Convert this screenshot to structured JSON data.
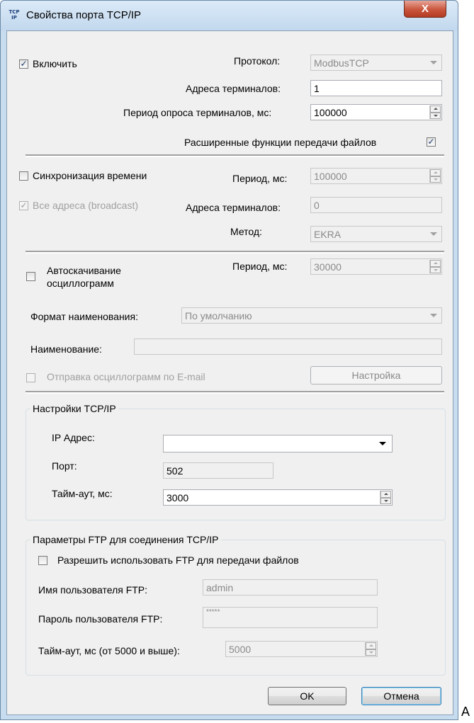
{
  "window": {
    "title": "Свойства порта TCP/IP",
    "icon_text_top": "TCP",
    "icon_text_bottom": "IP",
    "close_label": "X"
  },
  "general": {
    "enable_label": "Включить",
    "enable_checked": true,
    "protocol_label": "Протокол:",
    "protocol_value": "ModbusTCP",
    "terminal_addresses_label": "Адреса терминалов:",
    "terminal_addresses_value": "1",
    "poll_period_label": "Период опроса терминалов, мс:",
    "poll_period_value": "100000",
    "extended_ft_label": "Расширенные функции передачи файлов",
    "extended_ft_checked": true
  },
  "time_sync": {
    "sync_label": "Синхронизация времени",
    "sync_checked": false,
    "period_label": "Период, мс:",
    "period_value": "100000",
    "broadcast_label": "Все адреса (broadcast)",
    "broadcast_checked": true,
    "terminal_addresses_label": "Адреса терминалов:",
    "terminal_addresses_value": "0",
    "method_label": "Метод:",
    "method_value": "EKRA"
  },
  "oscillogram": {
    "autodownload_label_line1": "Автоскачивание",
    "autodownload_label_line2": "осциллограмм",
    "autodownload_checked": false,
    "period_label": "Период, мс:",
    "period_value": "30000",
    "naming_format_label": "Формат наименования:",
    "naming_format_value": "По умолчанию",
    "name_label": "Наименование:",
    "name_value": "",
    "email_label": "Отправка осциллограмм по E-mail",
    "email_checked": false,
    "settings_button": "Настройка"
  },
  "tcp": {
    "group_title": "Настройки TCP/IP",
    "ip_label": "IP Адрес:",
    "ip_value": "",
    "port_label": "Порт:",
    "port_value": "502",
    "timeout_label": "Тайм-аут, мс:",
    "timeout_value": "3000"
  },
  "ftp": {
    "group_title": "Параметры FTP для соединения TCP/IP",
    "allow_label": "Разрешить использовать FTP для передачи файлов",
    "allow_checked": false,
    "user_label": "Имя пользователя FTP:",
    "user_value": "admin",
    "password_label": "Пароль пользователя FTP:",
    "password_value": "*****",
    "timeout_label": "Тайм-аут, мс (от 5000 и выше):",
    "timeout_value": "5000"
  },
  "buttons": {
    "ok": "OK",
    "cancel": "Отмена"
  },
  "outside_text": "A"
}
